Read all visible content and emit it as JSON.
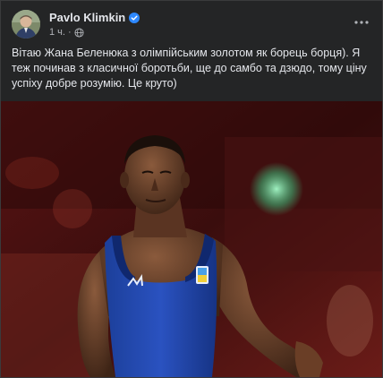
{
  "post": {
    "author": "Pavlo Klimkin",
    "time": "1 ч.",
    "separator": "·",
    "text": "Вітаю Жана Беленюка з олімпійським золотом як борець борця). Я теж починав з класичної боротьби, ще до самбо та дзюдо, тому ціну успіху добре розумію. Це круто)"
  },
  "icons": {
    "verified": "verified-badge-icon",
    "privacy": "globe-icon",
    "menu": "more-horizontal-icon"
  },
  "colors": {
    "card_bg": "#242526",
    "text_primary": "#e4e6eb",
    "text_secondary": "#b0b3b8",
    "verified_blue": "#2d88ff"
  }
}
